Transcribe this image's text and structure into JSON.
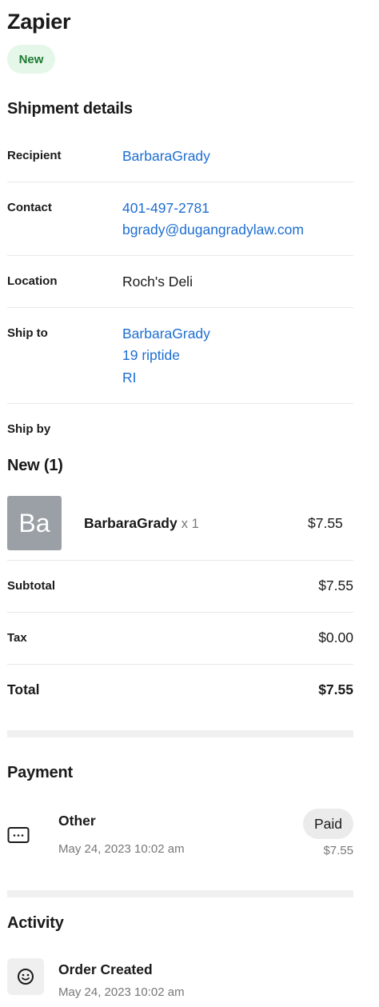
{
  "header": {
    "title": "Zapier",
    "status_badge": "New"
  },
  "shipment": {
    "heading": "Shipment details",
    "recipient": {
      "label": "Recipient",
      "value": "BarbaraGrady"
    },
    "contact": {
      "label": "Contact",
      "phone": "401-497-2781",
      "email": "bgrady@dugangradylaw.com"
    },
    "location": {
      "label": "Location",
      "value": "Roch's Deli"
    },
    "ship_to": {
      "label": "Ship to",
      "lines": [
        "BarbaraGrady",
        "19 riptide",
        "RI"
      ]
    },
    "ship_by": {
      "label": "Ship by"
    }
  },
  "items": {
    "heading": "New (1)",
    "list": [
      {
        "thumb_text": "Ba",
        "name": "BarbaraGrady",
        "qty": "x 1",
        "price": "$7.55"
      }
    ]
  },
  "summary": {
    "subtotal": {
      "label": "Subtotal",
      "value": "$7.55"
    },
    "tax": {
      "label": "Tax",
      "value": "$0.00"
    },
    "total": {
      "label": "Total",
      "value": "$7.55"
    }
  },
  "payment": {
    "heading": "Payment",
    "method": "Other",
    "date": "May 24, 2023 10:02 am",
    "status": "Paid",
    "amount": "$7.55",
    "icon": "card-dots-icon"
  },
  "activity": {
    "heading": "Activity",
    "events": [
      {
        "title": "Order Created",
        "date": "May 24, 2023 10:02 am",
        "icon": "smiley-icon"
      }
    ]
  },
  "colors": {
    "link": "#1e6ed2",
    "badge_bg": "#e5f7e8",
    "badge_text": "#1d7a32",
    "thumb_bg": "#9aa0a5"
  }
}
